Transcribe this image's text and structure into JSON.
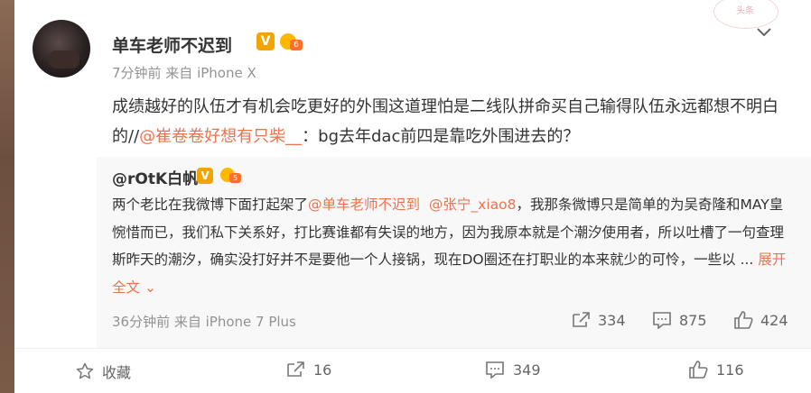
{
  "post": {
    "username": "单车老师不迟到",
    "verified_badge": "V",
    "fan_badge_level": "6",
    "meta": "7分钟前 来自 iPhone X",
    "text_parts": {
      "part1": "成绩越好的队伍才有机会吃更好的外围这道理怕是二线队拼命买自己输得队伍永远都想不明白的//",
      "mention": "@崔卷卷好想有只柴__",
      "part2": "：bg去年dac前四是靠吃外围进去的？"
    },
    "stamp_text": "头条"
  },
  "repost": {
    "username": "@rOtK白帆",
    "verified_badge": "V",
    "fan_badge_level": "5",
    "text_parts": {
      "part1": "两个老比在我微博下面打起架了",
      "mention1": "@单车老师不迟到",
      "mention2": "@张宁_xiao8",
      "part2": "，我那条微博只是简单的为吴奇隆和MAY皇惋惜而已，我们私下关系好，打比赛谁都有失误的地方，因为我原本就是个潮汐使用者，所以吐槽了一句查理斯昨天的潮汐，确实没打好并不是要他一个人接锅，现在DO圈还在打职业的本来就少的可怜，一些以 ... ",
      "expand": "展开全文"
    },
    "meta": "36分钟前 来自 iPhone 7 Plus",
    "stats": {
      "repost": "334",
      "comment": "875",
      "like": "424"
    }
  },
  "bottom_bar": {
    "favorite_label": "收藏",
    "repost": "16",
    "comment": "349",
    "like": "116"
  },
  "colors": {
    "accent": "#eb7350",
    "gray": "#939393"
  },
  "icons": [
    "star-icon",
    "share-icon",
    "comment-icon",
    "like-icon",
    "chevron-down-icon"
  ]
}
